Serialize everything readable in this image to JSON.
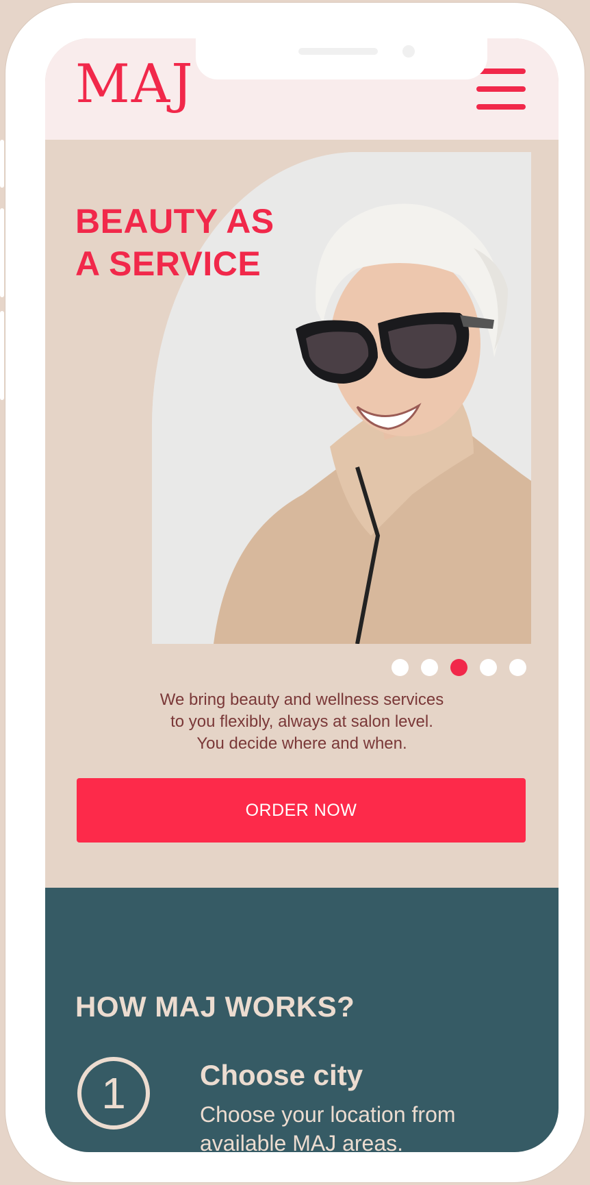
{
  "brand": {
    "logo": "MAJ",
    "accent": "#f1284a"
  },
  "header": {
    "menu_icon": "hamburger-menu-icon"
  },
  "hero": {
    "title_line1": "BEAUTY AS",
    "title_line2": "A SERVICE",
    "image_alt": "smiling-woman-with-sunglasses",
    "carousel": {
      "total": 5,
      "active_index": 3
    },
    "tagline_line1": "We bring beauty and wellness services",
    "tagline_line2": "to you flexibly, always at salon level.",
    "tagline_line3": "You decide where and when.",
    "cta_label": "ORDER NOW"
  },
  "how": {
    "title": "HOW MAJ WORKS?",
    "steps": [
      {
        "number": "1",
        "title": "Choose city",
        "description_line1": "Choose your location from",
        "description_line2": "available MAJ areas."
      }
    ]
  },
  "colors": {
    "page_bg": "#e5d4c7",
    "header_bg": "#f9ecec",
    "how_bg": "#365b65",
    "cta_bg": "#fd2a4a",
    "cream_text": "#ecdcd0"
  }
}
